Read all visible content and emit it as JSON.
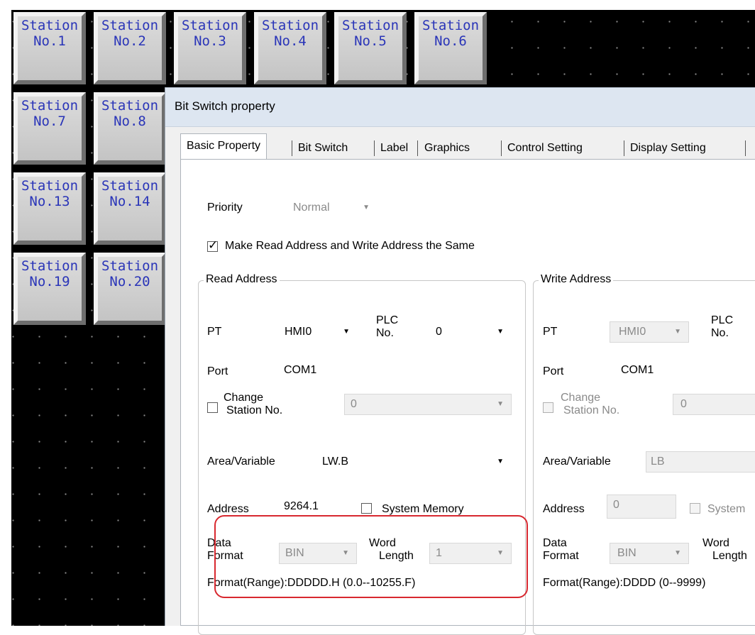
{
  "stations": [
    {
      "line1": "Station",
      "line2": "No.1"
    },
    {
      "line1": "Station",
      "line2": "No.2"
    },
    {
      "line1": "Station",
      "line2": "No.3"
    },
    {
      "line1": "Station",
      "line2": "No.4"
    },
    {
      "line1": "Station",
      "line2": "No.5"
    },
    {
      "line1": "Station",
      "line2": "No.6"
    },
    {
      "line1": "Station",
      "line2": "No.7"
    },
    {
      "line1": "Station",
      "line2": "No.8"
    },
    {
      "line1": "Station",
      "line2": "No.13"
    },
    {
      "line1": "Station",
      "line2": "No.14"
    },
    {
      "line1": "Station",
      "line2": "No.19"
    },
    {
      "line1": "Station",
      "line2": "No.20"
    }
  ],
  "dialog": {
    "title": "Bit Switch property",
    "tabs": [
      "Basic Property",
      "Bit Switch",
      "Label",
      "Graphics",
      "Control Setting",
      "Display Setting"
    ],
    "active_tab": "Basic Property",
    "priority": {
      "label": "Priority",
      "value": "Normal"
    },
    "same_address": {
      "label": "Make Read Address and Write Address the Same",
      "checked": true
    },
    "read": {
      "title": "Read Address",
      "pt_label": "PT",
      "pt_value": "HMI0",
      "plc_label_1": "PLC",
      "plc_label_2": "No.",
      "plc_value": "0",
      "port_label": "Port",
      "port_value": "COM1",
      "change_1": "Change",
      "change_2": "Station No.",
      "change_value": "0",
      "area_label": "Area/Variable",
      "area_value": "LW.B",
      "address_label": "Address",
      "address_value": "9264.1",
      "sysmem_label": "System Memory",
      "data_format_1": "Data",
      "data_format_2": "Format",
      "data_format_value": "BIN",
      "word_length_1": "Word",
      "word_length_2": "Length",
      "word_length_value": "1",
      "format_range": "Format(Range):DDDDD.H (0.0--10255.F)"
    },
    "write": {
      "title": "Write Address",
      "pt_label": "PT",
      "pt_value": "HMI0",
      "plc_label_1": "PLC",
      "plc_label_2": "No.",
      "port_label": "Port",
      "port_value": "COM1",
      "change_1": "Change",
      "change_2": "Station No.",
      "change_value": "0",
      "area_label": "Area/Variable",
      "area_value": "LB",
      "address_label": "Address",
      "address_value": "0",
      "sysmem_label": "System",
      "data_format_1": "Data",
      "data_format_2": "Format",
      "data_format_value": "BIN",
      "word_length_1": "Word",
      "word_length_2": "Length",
      "format_range": "Format(Range):DDDD (0--9999)"
    }
  },
  "colors": {
    "highlight": "#d8282f",
    "station_text": "#2a35b8"
  }
}
